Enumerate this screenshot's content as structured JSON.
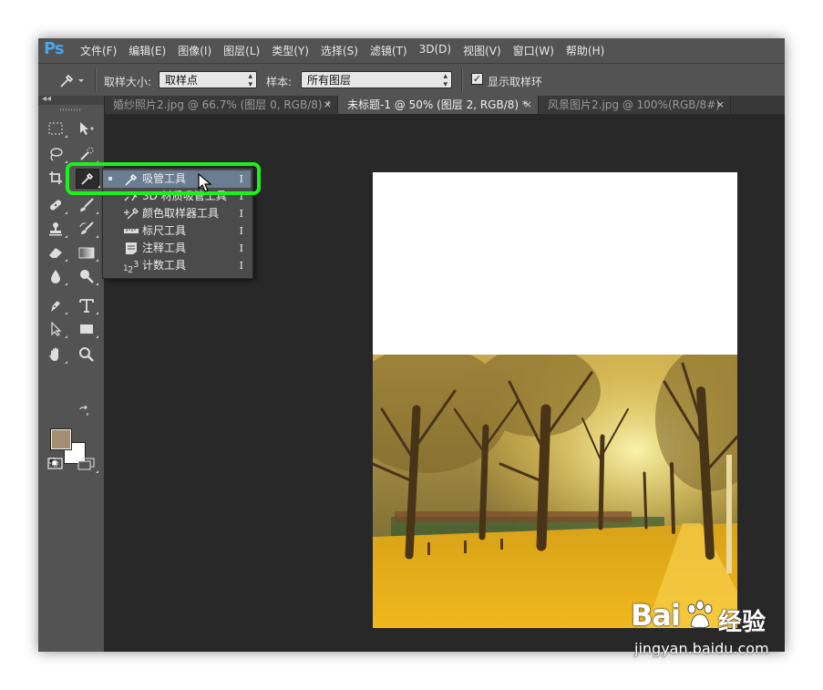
{
  "app": {
    "logo": "Ps"
  },
  "menu": [
    "文件(F)",
    "编辑(E)",
    "图像(I)",
    "图层(L)",
    "类型(Y)",
    "选择(S)",
    "滤镜(T)",
    "3D(D)",
    "视图(V)",
    "窗口(W)",
    "帮助(H)"
  ],
  "options": {
    "sample_size_label": "取样大小:",
    "sample_size_value": "取样点",
    "sample_label": "样本:",
    "sample_value": "所有图层",
    "show_ring_label": "显示取样环",
    "show_ring_checked": true
  },
  "tabs": [
    {
      "label": "婚纱照片2.jpg @ 66.7% (图层 0, RGB/8) *",
      "active": false
    },
    {
      "label": "未标题-1 @ 50% (图层 2, RGB/8) *",
      "active": true
    },
    {
      "label": "风景图片2.jpg @ 100%(RGB/8#)",
      "active": false
    }
  ],
  "tab_close": "×",
  "toolbox": {
    "collapse": "◂◂",
    "foreground_color": "#a38e74",
    "background_color": "#ffffff"
  },
  "flyout": {
    "items": [
      {
        "label": "吸管工具",
        "shortcut": "I",
        "icon": "eyedropper-icon",
        "active": true
      },
      {
        "label": "3D 材质吸管工具",
        "shortcut": "I",
        "icon": "3d-material-eyedropper-icon",
        "active": false
      },
      {
        "label": "颜色取样器工具",
        "shortcut": "I",
        "icon": "color-sampler-icon",
        "active": false
      },
      {
        "label": "标尺工具",
        "shortcut": "I",
        "icon": "ruler-icon",
        "active": false
      },
      {
        "label": "注释工具",
        "shortcut": "I",
        "icon": "note-icon",
        "active": false
      },
      {
        "label": "计数工具",
        "shortcut": "I",
        "icon": "count-icon",
        "active": false
      }
    ]
  },
  "colors": {
    "highlight": "#1ef01e",
    "accent": "#48a7e8"
  },
  "watermark": {
    "logo": "Bai",
    "brand_cn": "经验",
    "url": "jingyan.baidu.com"
  }
}
